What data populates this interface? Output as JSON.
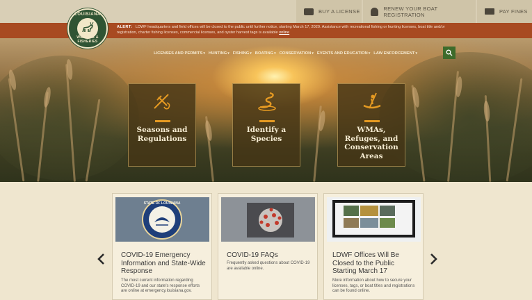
{
  "logo": {
    "top_text": "LOUISIANA",
    "bottom_text": "WILDLIFE & FISHERIES"
  },
  "utility": {
    "buy_license": "BUY A LICENSE",
    "renew_boat": "RENEW YOUR BOAT REGISTRATION",
    "pay_fines": "PAY FINES"
  },
  "alert": {
    "label": "ALERT:",
    "text": "LDWF headquarters and field offices will be closed to the public until further notice, starting March 17, 2020. Assistance with recreational fishing or hunting licenses, boat title and/or registration, charter fishing licenses, commercial licenses, and oyster harvest tags is available",
    "link": "online"
  },
  "nav": {
    "items": [
      {
        "label": "LICENSES AND PERMITS"
      },
      {
        "label": "HUNTING"
      },
      {
        "label": "FISHING"
      },
      {
        "label": "BOATING"
      },
      {
        "label": "CONSERVATION"
      },
      {
        "label": "EVENTS AND EDUCATION"
      },
      {
        "label": "LAW ENFORCEMENT"
      }
    ]
  },
  "features": [
    {
      "label": "Seasons and Regulations",
      "icon": "fishing-rod-icon"
    },
    {
      "label": "Identify a Species",
      "icon": "snake-icon"
    },
    {
      "label": "WMAs, Refuges, and Conservation Areas",
      "icon": "kayaker-icon"
    }
  ],
  "cards": [
    {
      "title": "COVID-19 Emergency Information and State-Wide Response",
      "desc": "The most current information regarding COVID-19 and our state's response efforts are online at emergency.louisiana.gov.",
      "seal_text": "STATE OF LOUISIANA",
      "image": "louisiana-state-seal"
    },
    {
      "title": "COVID-19 FAQs",
      "desc": "Frequently asked questions about COVID-19 are available online.",
      "image": "coronavirus-image"
    },
    {
      "title": "LDWF Offices Will Be Closed to the Public Starting March 17",
      "desc": "More information about how to secure your licenses, tags, or boat titles and registrations can be found online.",
      "image": "computer-screen-photo"
    }
  ],
  "colors": {
    "alert": "#a84a21",
    "accent": "#e59a22",
    "search": "#3d6b2b"
  }
}
